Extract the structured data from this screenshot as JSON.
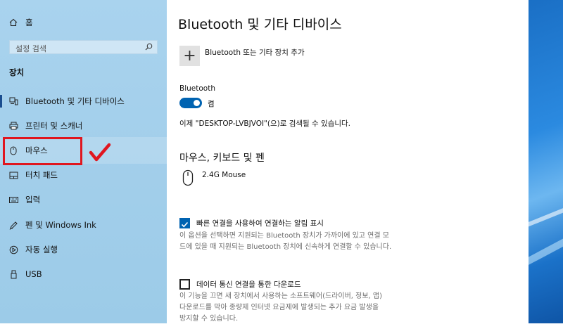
{
  "sidebar": {
    "home_label": "홈",
    "search_placeholder": "설정 검색",
    "section_title": "장치",
    "items": [
      {
        "label": "Bluetooth 및 기타 디바이스"
      },
      {
        "label": "프린터 및 스캐너"
      },
      {
        "label": "마우스"
      },
      {
        "label": "터치 패드"
      },
      {
        "label": "입력"
      },
      {
        "label": "펜 및 Windows Ink"
      },
      {
        "label": "자동 실행"
      },
      {
        "label": "USB"
      }
    ]
  },
  "main": {
    "title": "Bluetooth 및 기타 디바이스",
    "add_device_label": "Bluetooth 또는 기타 장치 추가",
    "bluetooth_label": "Bluetooth",
    "toggle_state": "켬",
    "discoverable_text": "이제 \"DESKTOP-LVBJVOI\"(으)로 검색될 수 있습니다.",
    "section_heading": "마우스, 키보드 및 펜",
    "device_name": "2.4G Mouse",
    "swift_pair_label": "빠른 연결을 사용하여 연결하는 알림 표시",
    "swift_pair_desc_line1": "이 옵션을 선택하면 지원되는 Bluetooth 장치가 가까이에 있고 연결 모",
    "swift_pair_desc_line2": "드에 있을 때 지원되는 Bluetooth 장치에 신속하게 연결할 수 있습니다.",
    "metered_label": "데이터 통신 연결을 통한 다운로드",
    "metered_desc_line1": "이 기능을 끄면 새 장치에서 사용하는 소프트웨어(드라이버, 정보, 앱)",
    "metered_desc_line2": "다운로드를 막아 종량제 인터넷 요금제에 발생되는 추가 요금 발생을",
    "metered_desc_line3": "방지할 수 있습니다."
  },
  "colors": {
    "accent": "#0063b1",
    "annotation_red": "#e0161f",
    "sidebar_bg": "#a9d3ee"
  }
}
